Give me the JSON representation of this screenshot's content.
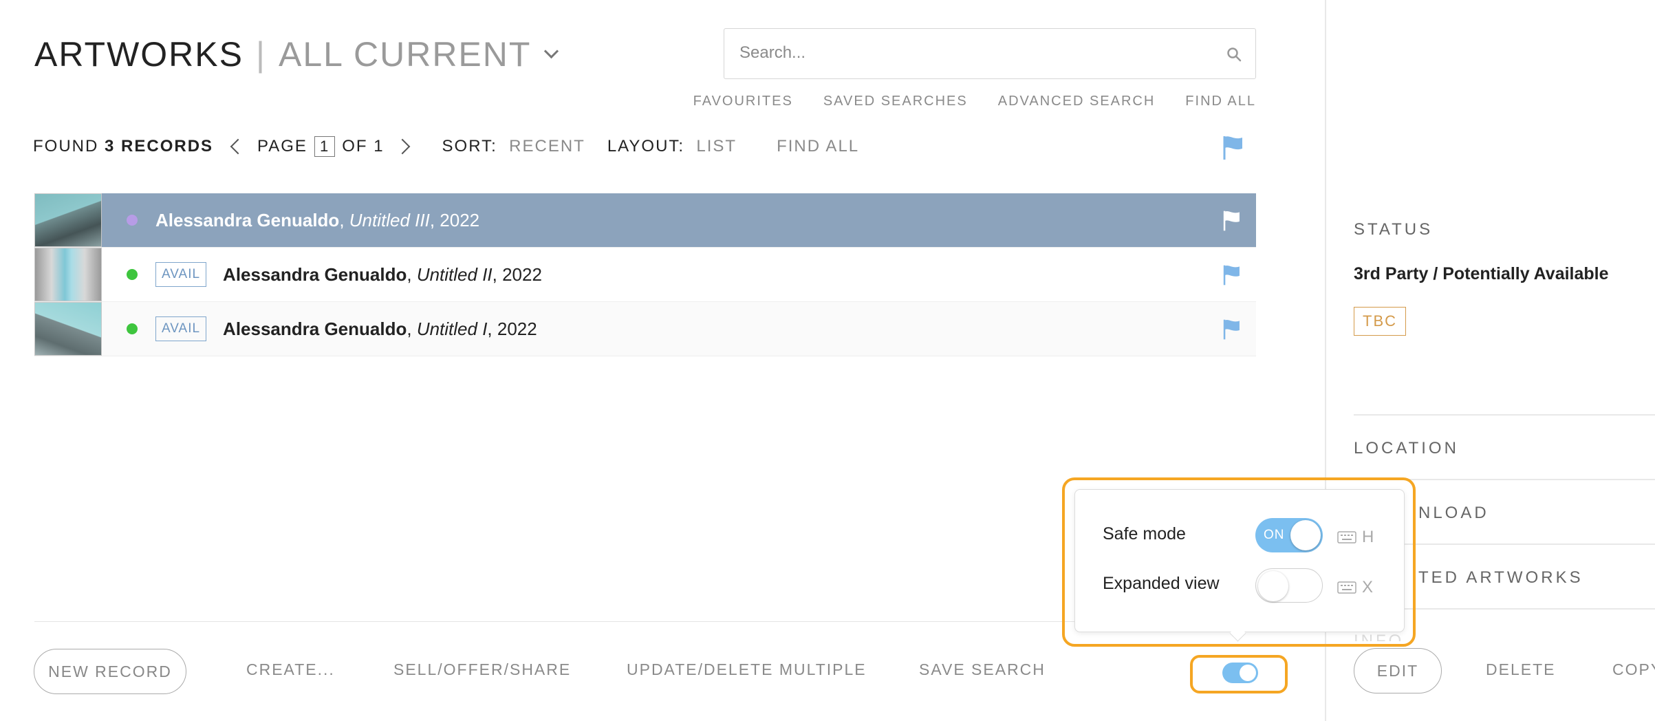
{
  "header": {
    "title": "ARTWORKS",
    "separator": "|",
    "view": "ALL CURRENT"
  },
  "search": {
    "placeholder": "Search..."
  },
  "quick_links": [
    "FAVOURITES",
    "SAVED SEARCHES",
    "ADVANCED SEARCH",
    "FIND ALL"
  ],
  "toolbar": {
    "found_prefix": "FOUND",
    "count": "3 RECORDS",
    "page_label": "PAGE",
    "page": "1",
    "of_label": "OF 1",
    "sort_label": "SORT:",
    "sort_value": "RECENT",
    "layout_label": "LAYOUT:",
    "layout_value": "LIST",
    "find_all": "FIND ALL"
  },
  "rows": [
    {
      "artist": "Alessandra Genualdo",
      "title": "Untitled III",
      "year": ", 2022",
      "badge": "",
      "status_color": "#b79ce6",
      "selected": true
    },
    {
      "artist": "Alessandra Genualdo",
      "title": "Untitled II",
      "year": ", 2022",
      "badge": "AVAIL",
      "status_color": "#3ec53e",
      "selected": false
    },
    {
      "artist": "Alessandra Genualdo",
      "title": "Untitled I",
      "year": ", 2022",
      "badge": "AVAIL",
      "status_color": "#3ec53e",
      "selected": false
    }
  ],
  "bottom": {
    "new_record": "NEW RECORD",
    "create": "CREATE...",
    "sell": "SELL/OFFER/SHARE",
    "update": "UPDATE/DELETE MULTIPLE",
    "save_search": "SAVE SEARCH"
  },
  "popup": {
    "safe_mode_label": "Safe mode",
    "safe_mode_state": "ON",
    "safe_mode_key": "H",
    "expanded_label": "Expanded view",
    "expanded_key": "X"
  },
  "detail": {
    "status_header": "STATUS",
    "status_value": "3rd Party / Potentially Available",
    "status_badge": "TBC",
    "location_header": "LOCATION",
    "download_header": "NLOAD",
    "related_header": "TED ARTWORKS",
    "info_header": "INFO",
    "edit": "EDIT",
    "delete": "DELETE",
    "copy": "COPY"
  },
  "colors": {
    "selected_row": "#8ca3bc",
    "accent_blue": "#7bbff0",
    "highlight": "#f5a623",
    "tbc": "#d49a4a"
  }
}
